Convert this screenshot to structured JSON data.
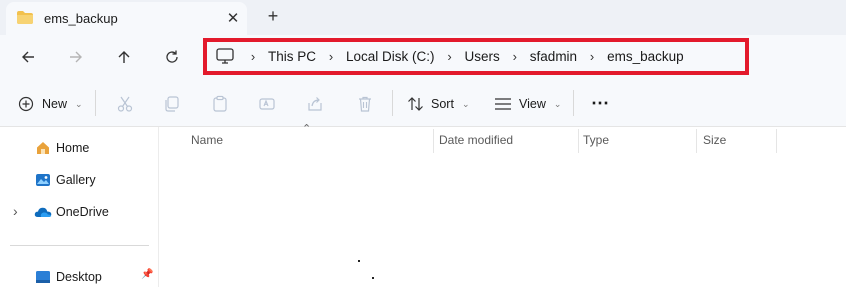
{
  "tab": {
    "title": "ems_backup",
    "close_glyph": "✕",
    "new_tab_glyph": "+"
  },
  "navigation": {
    "back_icon": "back-arrow-icon",
    "forward_icon": "forward-arrow-icon",
    "up_icon": "up-arrow-icon",
    "refresh_icon": "refresh-icon"
  },
  "breadcrumb": {
    "items": [
      "This PC",
      "Local Disk (C:)",
      "Users",
      "sfadmin",
      "ems_backup"
    ],
    "separator": "›"
  },
  "highlight_color": "#e31a2c",
  "toolbar": {
    "new_label": "New",
    "sort_label": "Sort",
    "view_label": "View",
    "more_glyph": "⋯",
    "dropdown_glyph": "⌄"
  },
  "sidebar": {
    "items": [
      {
        "label": "Home",
        "icon": "home-icon"
      },
      {
        "label": "Gallery",
        "icon": "gallery-icon"
      },
      {
        "label": "OneDrive",
        "icon": "onedrive-icon"
      },
      {
        "label": "Desktop",
        "icon": "desktop-icon"
      }
    ],
    "expand_glyph": "›",
    "pin_glyph": "📌"
  },
  "columns": {
    "name": "Name",
    "date_modified": "Date modified",
    "type": "Type",
    "size": "Size",
    "sort_glyph": "⌃"
  }
}
